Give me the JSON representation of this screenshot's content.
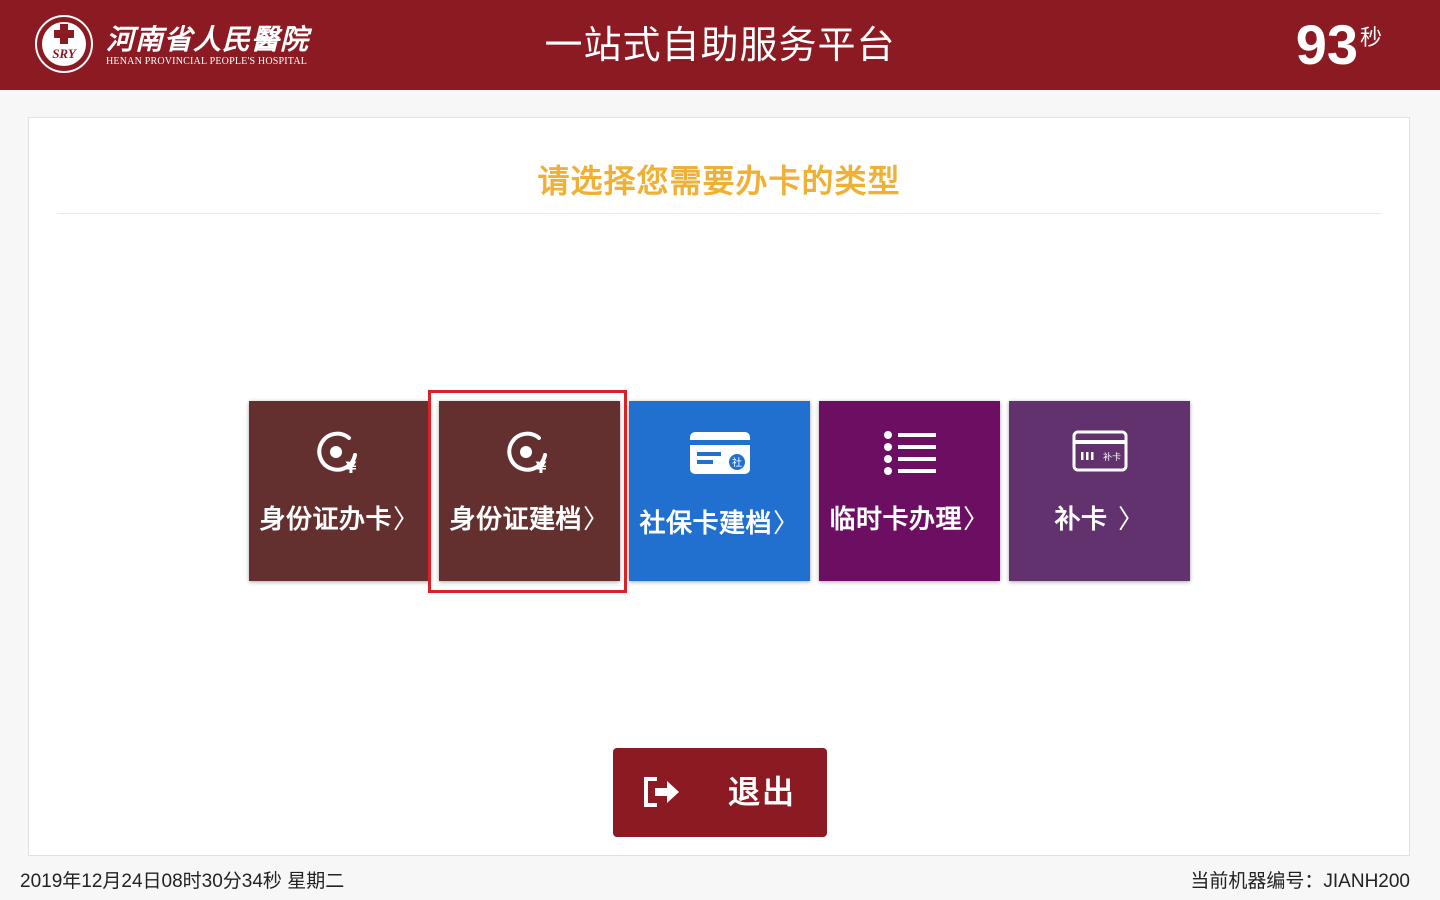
{
  "header": {
    "logo_name_cn": "河南省人民醫院",
    "logo_name_en": "HENAN PROVINCIAL PEOPLE'S HOSPITAL",
    "logo_emblem_text": "SRY",
    "title": "一站式自助服务平台",
    "countdown_value": "93",
    "countdown_unit": "秒",
    "background_color": "#8b1a22"
  },
  "main": {
    "prompt": "请选择您需要办卡的类型",
    "prompt_color": "#efb135",
    "options": [
      {
        "label": "身份证办卡",
        "icon": "id-coin-icon",
        "color": "#64302f",
        "selected": false
      },
      {
        "label": "身份证建档",
        "icon": "id-coin-icon",
        "color": "#64302f",
        "selected": true
      },
      {
        "label": "社保卡建档",
        "icon": "social-security-card-icon",
        "color": "#2170d0",
        "selected": false
      },
      {
        "label": "临时卡办理",
        "icon": "list-icon",
        "color": "#6c0f63",
        "selected": false
      },
      {
        "label": "补卡",
        "icon": "card-icon",
        "color": "#61326e",
        "selected": false
      }
    ],
    "chevron": "〉",
    "coin_symbol": "¥",
    "social_card_mark": "社",
    "replace_card_mark": "补卡",
    "exit_label": "退出"
  },
  "footer": {
    "datetime": "2019年12月24日08时30分34秒 星期二",
    "machine_id_label": "当前机器编号：JIANH200"
  }
}
